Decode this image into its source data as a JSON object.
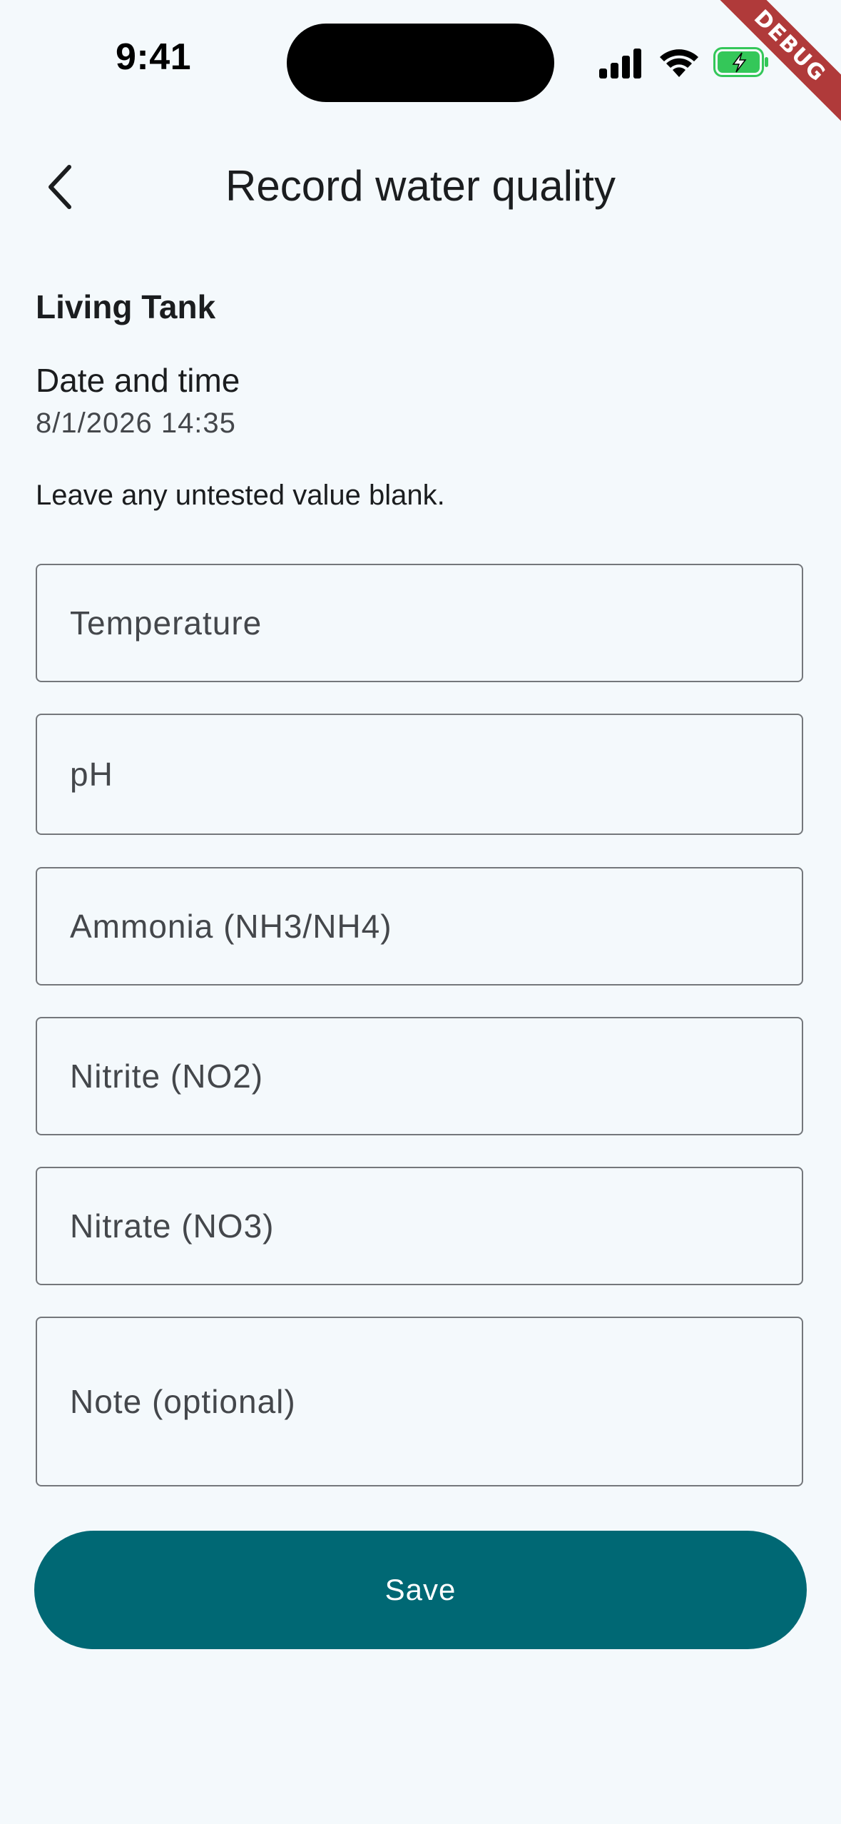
{
  "status_bar": {
    "time": "9:41",
    "icons": [
      "signal-icon",
      "wifi-icon",
      "battery-charging-icon"
    ]
  },
  "debug_banner": "DEBUG",
  "app_bar": {
    "back_icon": "chevron-left-icon",
    "title": "Record water quality"
  },
  "tank": {
    "name": "Living Tank"
  },
  "date_time": {
    "label": "Date and time",
    "value": "8/1/2026 14:35"
  },
  "hint": "Leave any untested value blank.",
  "fields": {
    "temperature": {
      "placeholder": "Temperature",
      "value": ""
    },
    "ph": {
      "placeholder": "pH",
      "value": ""
    },
    "ammonia": {
      "placeholder": "Ammonia (NH3/NH4)",
      "value": ""
    },
    "nitrite": {
      "placeholder": "Nitrite (NO2)",
      "value": ""
    },
    "nitrate": {
      "placeholder": "Nitrate (NO3)",
      "value": ""
    },
    "note": {
      "placeholder": "Note (optional)",
      "value": ""
    }
  },
  "actions": {
    "save_label": "Save"
  },
  "colors": {
    "background": "#f4f9fc",
    "primary": "#006874",
    "outline": "#74777b",
    "debug": "#b03a3a",
    "battery": "#34c759"
  }
}
